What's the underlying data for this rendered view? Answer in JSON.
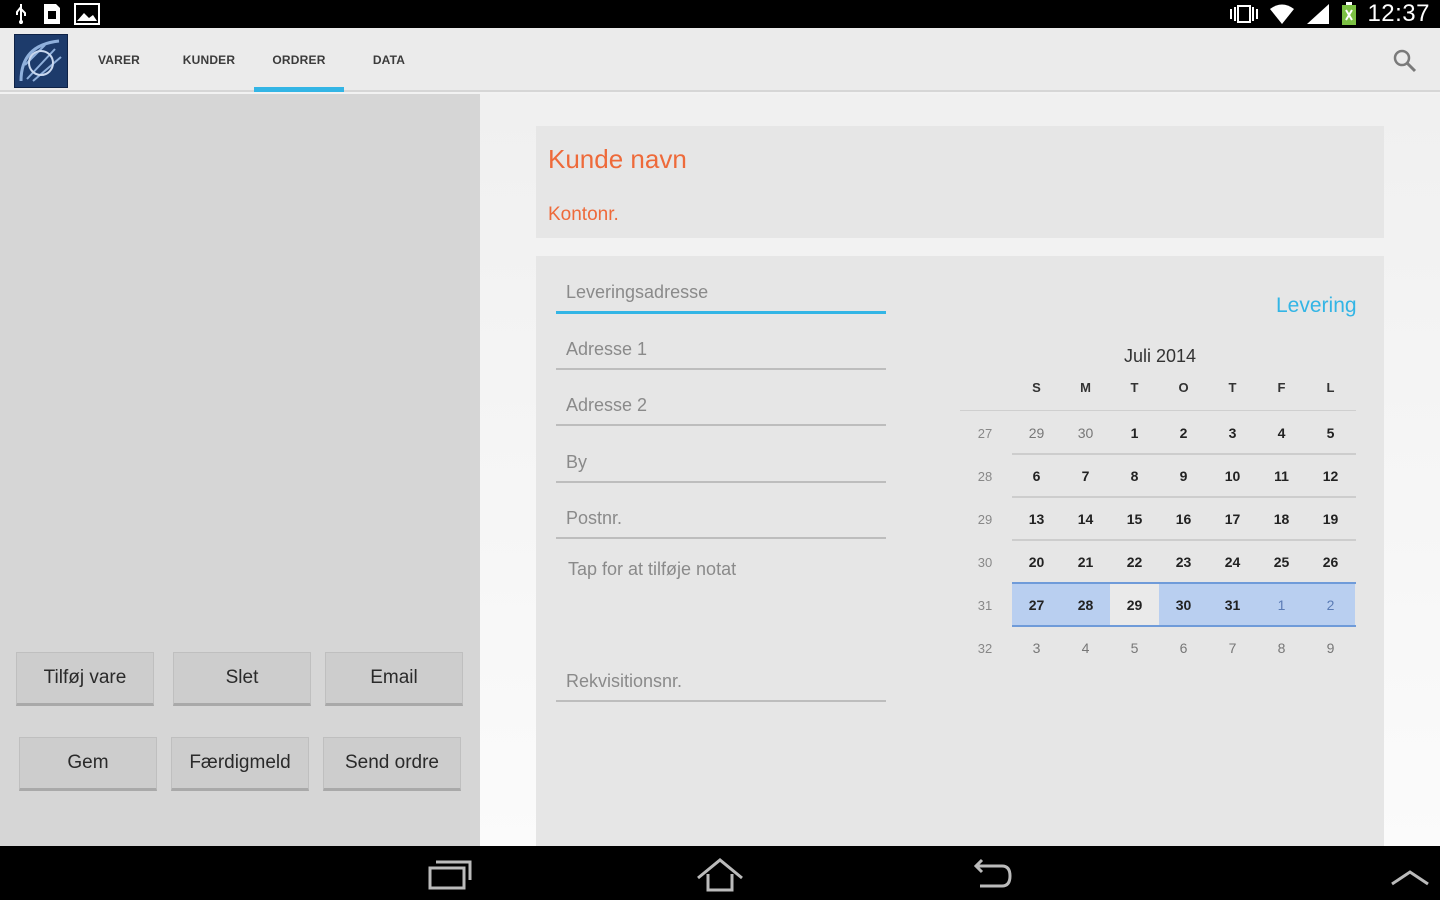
{
  "status_bar": {
    "time": "12:37",
    "left_icons": [
      "usb-icon",
      "sd-card-icon",
      "gallery-icon"
    ],
    "right_icons": [
      "mute-vibrate-icon",
      "wifi-icon",
      "signal-icon",
      "battery-icon"
    ]
  },
  "action_bar": {
    "tabs": [
      {
        "label": "VARER",
        "active": false
      },
      {
        "label": "KUNDER",
        "active": false
      },
      {
        "label": "ORDRER",
        "active": true
      },
      {
        "label": "DATA",
        "active": false
      }
    ],
    "accent_color": "#33b5e5"
  },
  "left_panel": {
    "buttons": {
      "add_item": "Tilføj vare",
      "delete": "Slet",
      "email": "Email",
      "save": "Gem",
      "complete": "Færdigmeld",
      "send_order": "Send ordre"
    }
  },
  "customer": {
    "name_label": "Kunde navn",
    "account_label": "Kontonr.",
    "label_color": "#ee6a3a"
  },
  "form": {
    "delivery_address": "Leveringsadresse",
    "address1": "Adresse 1",
    "address2": "Adresse 2",
    "city": "By",
    "postal": "Postnr.",
    "note": "Tap for at tilføje notat",
    "requisition": "Rekvisitionsnr."
  },
  "delivery": {
    "label": "Levering",
    "calendar": {
      "month_title": "Juli 2014",
      "weekday_headers": [
        "S",
        "M",
        "T",
        "O",
        "T",
        "F",
        "L"
      ],
      "weeks": [
        {
          "week": "27",
          "days": [
            {
              "d": "29",
              "o": true
            },
            {
              "d": "30",
              "o": true
            },
            {
              "d": "1"
            },
            {
              "d": "2"
            },
            {
              "d": "3"
            },
            {
              "d": "4"
            },
            {
              "d": "5"
            }
          ]
        },
        {
          "week": "28",
          "days": [
            {
              "d": "6"
            },
            {
              "d": "7"
            },
            {
              "d": "8"
            },
            {
              "d": "9"
            },
            {
              "d": "10"
            },
            {
              "d": "11"
            },
            {
              "d": "12"
            }
          ]
        },
        {
          "week": "29",
          "days": [
            {
              "d": "13"
            },
            {
              "d": "14"
            },
            {
              "d": "15"
            },
            {
              "d": "16"
            },
            {
              "d": "17"
            },
            {
              "d": "18"
            },
            {
              "d": "19"
            }
          ]
        },
        {
          "week": "30",
          "days": [
            {
              "d": "20"
            },
            {
              "d": "21"
            },
            {
              "d": "22"
            },
            {
              "d": "23"
            },
            {
              "d": "24"
            },
            {
              "d": "25"
            },
            {
              "d": "26"
            }
          ]
        },
        {
          "week": "31",
          "selected": true,
          "days": [
            {
              "d": "27"
            },
            {
              "d": "28"
            },
            {
              "d": "29",
              "today": true
            },
            {
              "d": "30"
            },
            {
              "d": "31"
            },
            {
              "d": "1",
              "o": true
            },
            {
              "d": "2",
              "o": true
            }
          ]
        },
        {
          "week": "32",
          "days": [
            {
              "d": "3",
              "o": true
            },
            {
              "d": "4",
              "o": true
            },
            {
              "d": "5",
              "o": true
            },
            {
              "d": "6",
              "o": true
            },
            {
              "d": "7",
              "o": true
            },
            {
              "d": "8",
              "o": true
            },
            {
              "d": "9",
              "o": true
            }
          ]
        }
      ]
    }
  },
  "nav_bar": {
    "icons": [
      "recent-apps-icon",
      "home-icon",
      "back-icon",
      "menu-up-icon"
    ]
  }
}
